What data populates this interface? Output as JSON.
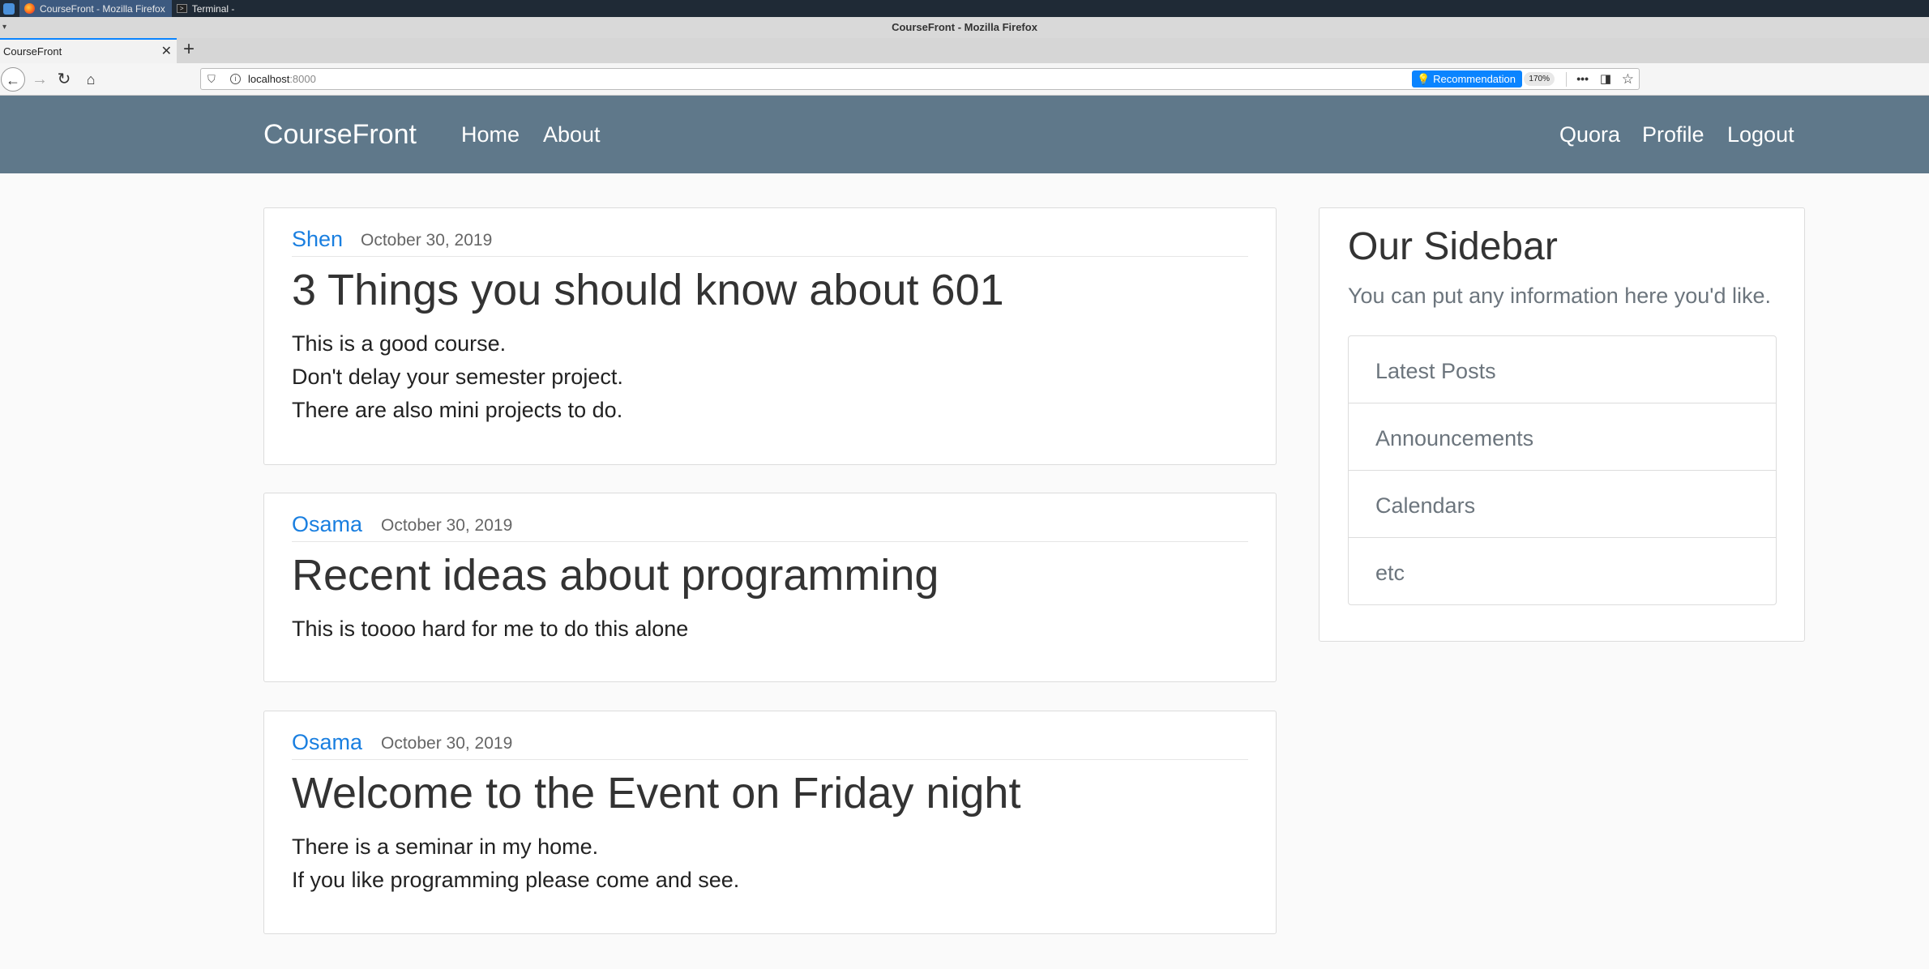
{
  "taskbar": {
    "tasks": [
      {
        "label": "CourseFront - Mozilla Firefox"
      },
      {
        "label": "Terminal -"
      }
    ]
  },
  "browser": {
    "window_title": "CourseFront - Mozilla Firefox",
    "tab_title": "CourseFront",
    "tab_close": "✕",
    "new_tab": "+",
    "url_host": "localhost",
    "url_port": ":8000",
    "recommendation_label": "Recommendation",
    "zoom": "170%",
    "icons": {
      "back": "back-arrow-icon",
      "forward": "forward-arrow-icon",
      "reload": "reload-icon",
      "home": "home-icon",
      "shield": "shield-icon",
      "info": "info-icon",
      "more": "more-icon",
      "pocket": "pocket-icon",
      "bookmark": "star-icon"
    }
  },
  "site": {
    "brand": "CourseFront",
    "nav_left": [
      {
        "label": "Home"
      },
      {
        "label": "About"
      }
    ],
    "nav_right": [
      {
        "label": "Quora"
      },
      {
        "label": "Profile"
      },
      {
        "label": "Logout"
      }
    ],
    "colors": {
      "navbar": "#5f788a",
      "author_link": "#1a7fe0"
    }
  },
  "posts": [
    {
      "author": "Shen",
      "date": "October 30, 2019",
      "title": "3 Things you should know about 601",
      "body": [
        "This is a good course.",
        "Don't delay your semester project.",
        "There are also mini projects to do."
      ]
    },
    {
      "author": "Osama",
      "date": "October 30, 2019",
      "title": "Recent ideas about programming",
      "body": [
        "This is toooo hard for me to do this alone"
      ]
    },
    {
      "author": "Osama",
      "date": "October 30, 2019",
      "title": "Welcome to the Event on Friday night",
      "body": [
        "There is a seminar in my home.",
        "If you like programming please come and see."
      ]
    }
  ],
  "sidebar": {
    "title": "Our Sidebar",
    "text": "You can put any information here you'd like.",
    "items": [
      {
        "label": "Latest Posts"
      },
      {
        "label": "Announcements"
      },
      {
        "label": "Calendars"
      },
      {
        "label": "etc"
      }
    ]
  }
}
